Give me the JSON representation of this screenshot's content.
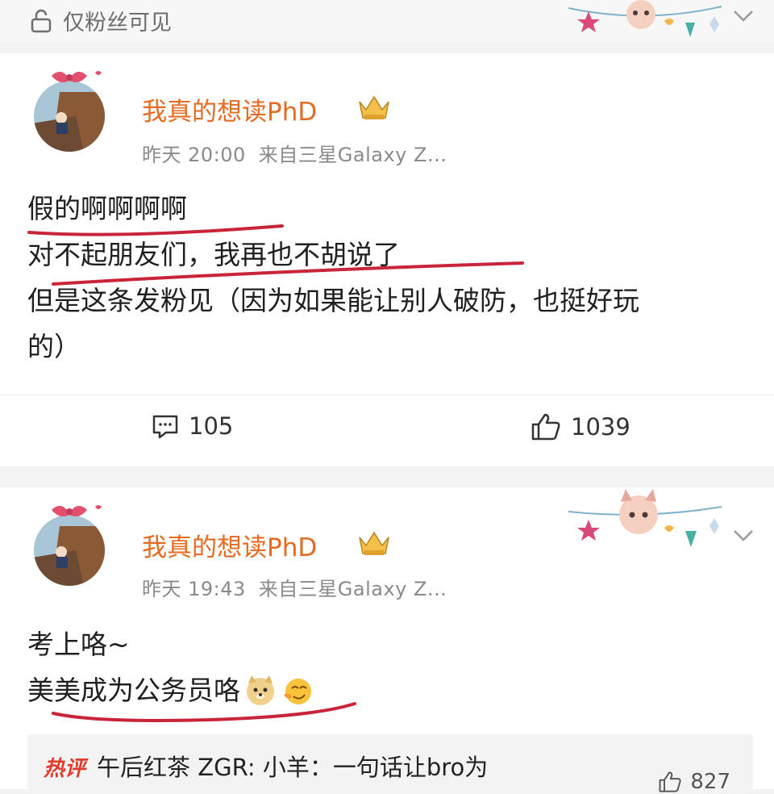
{
  "top": {
    "visibility_label": "仅粉丝可见",
    "icon": "lock-icon"
  },
  "posts": [
    {
      "username": "我真的想读PhD",
      "time": "昨天 20:00",
      "source": "来自三星Galaxy Z...",
      "lines": [
        "假的啊啊啊啊",
        "对不起朋友们，我再也不胡说了",
        "但是这条发粉见（因为如果能让别人破防，也挺好玩",
        "的）"
      ],
      "comments": "105",
      "likes": "1039"
    },
    {
      "username": "我真的想读PhD",
      "time": "昨天 19:43",
      "source": "来自三星Galaxy Z...",
      "lines": [
        "考上咯~",
        "美美成为公务员咯"
      ]
    }
  ],
  "hot_comment": {
    "tag": "热评",
    "text": "午后红茶 ZGR: 小羊：一句话让bro为",
    "count": "827"
  },
  "colors": {
    "username": "#e66a1f",
    "underline": "#c8253a",
    "hot_tag": "#e23b2d"
  }
}
